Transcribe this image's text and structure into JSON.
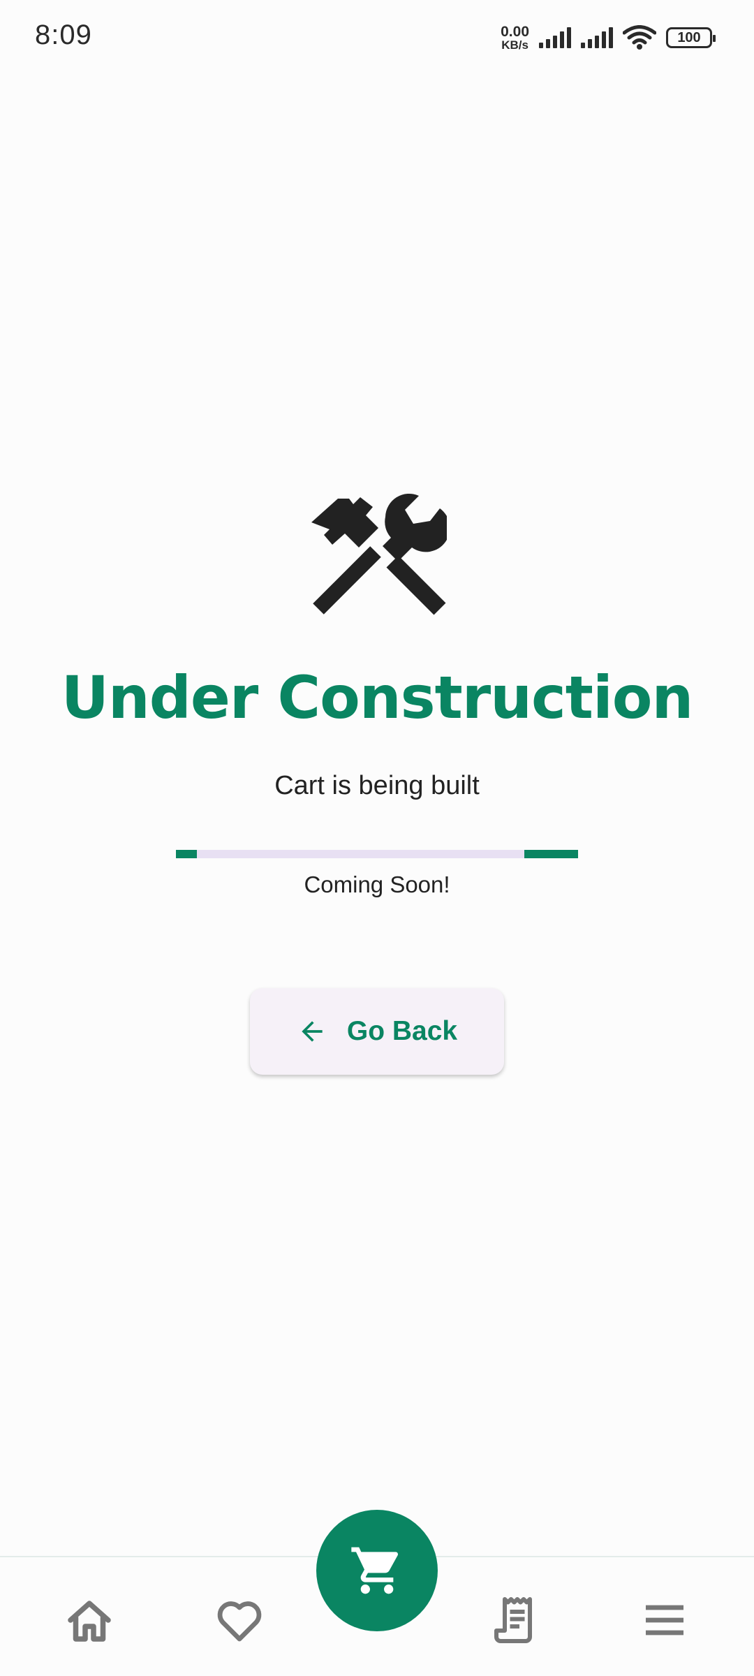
{
  "status_bar": {
    "time": "8:09",
    "net_speed_value": "0.00",
    "net_speed_unit": "KB/s",
    "battery": "100"
  },
  "main": {
    "icon": "tools-icon",
    "title": "Under Construction",
    "subtitle": "Cart is being built",
    "coming_soon": "Coming Soon!",
    "back_button_label": "Go Back"
  },
  "bottom_nav": {
    "items": [
      {
        "name": "home",
        "icon": "home-icon"
      },
      {
        "name": "favorites",
        "icon": "heart-icon"
      },
      {
        "name": "cart",
        "icon": "cart-icon",
        "selected": true
      },
      {
        "name": "orders",
        "icon": "receipt-icon"
      },
      {
        "name": "menu",
        "icon": "menu-icon"
      }
    ]
  },
  "colors": {
    "accent": "#0a8562",
    "progress_track": "#e8e0f3",
    "button_bg": "#f6f1f8",
    "nav_icon": "#777777"
  }
}
